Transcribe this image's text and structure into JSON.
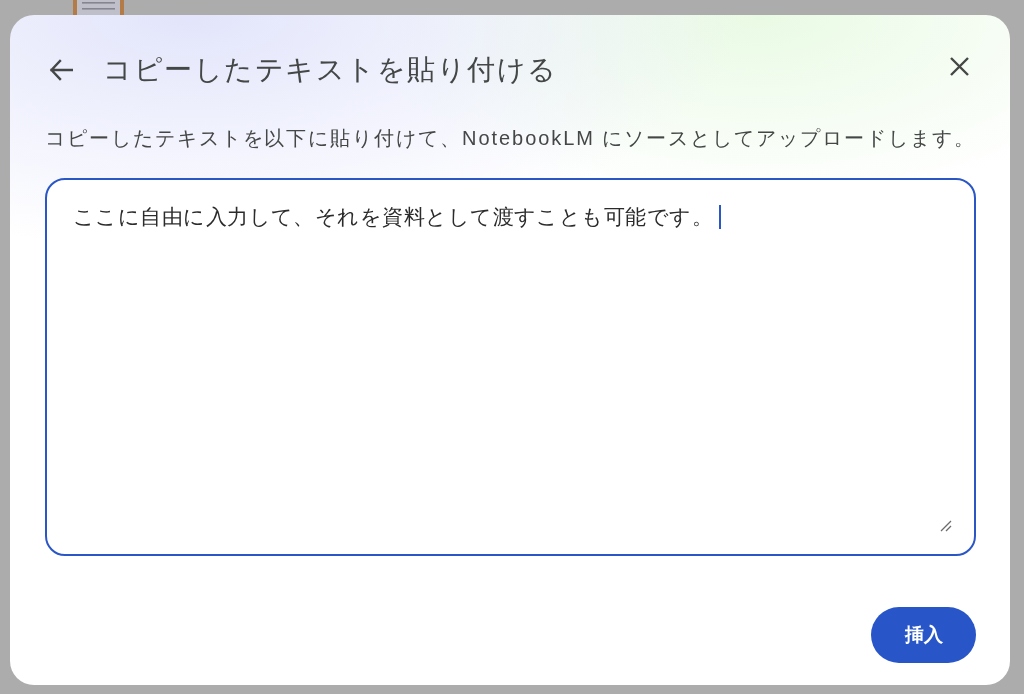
{
  "dialog": {
    "title": "コピーしたテキストを貼り付ける",
    "description": "コピーしたテキストを以下に貼り付けて、NotebookLM にソースとしてアップロードします。",
    "text_input": {
      "value": "ここに自由に入力して、それを資料として渡すことも可能です。",
      "focused": true
    },
    "insert_button": {
      "label": "挿入"
    }
  }
}
